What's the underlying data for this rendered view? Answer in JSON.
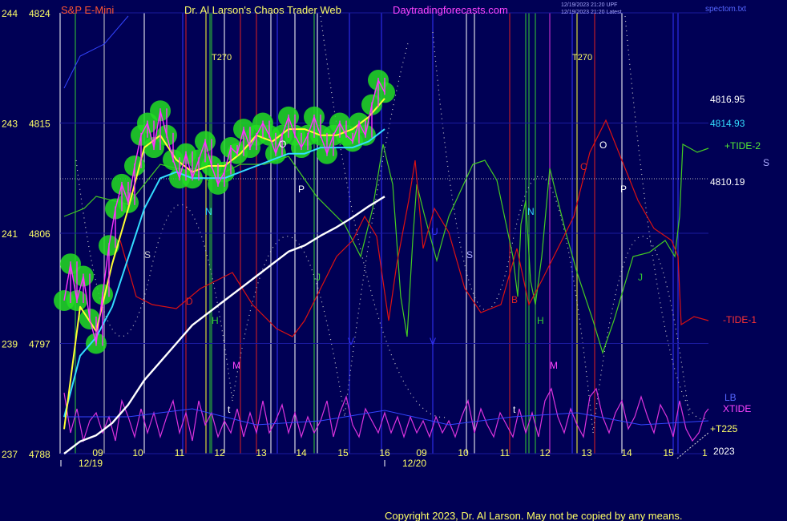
{
  "header": {
    "left_title": "S&P E-Mini",
    "center_title": "Dr. Al Larson's Chaos Trader Web",
    "site": "Daytradingforecasts.com",
    "stamp_line1": "12/19/2023 21:20 UPF",
    "stamp_line2": "12/19/2023 21:20 Latest",
    "file": "spectom.txt"
  },
  "footer": {
    "copyright": "Copyright 2023, Dr. Al Larson. May not be copied by any means."
  },
  "colors": {
    "background": "#000055",
    "price_bars": "#ff33ff",
    "glow": "#22dd22",
    "ma_fast": "#ffff33",
    "ma_mid": "#33ddff",
    "ma_slow": "#ffffff",
    "tide1": "#dd1111",
    "tide2": "#44cc22",
    "xtide": "#dd33dd"
  },
  "chart_data": {
    "type": "line",
    "title": "S&P E-Mini",
    "y_axis_left": [
      {
        "tide": "244",
        "price": "4824"
      },
      {
        "tide": "243",
        "price": "4815"
      },
      {
        "tide": "241",
        "price": "4806"
      },
      {
        "tide": "239",
        "price": "4797"
      },
      {
        "tide": "237",
        "price": "4788"
      }
    ],
    "y_range": [
      4788,
      4824
    ],
    "x_hour_labels": [
      "09",
      "10",
      "11",
      "12",
      "13",
      "14",
      "15",
      "16",
      "09",
      "10",
      "11",
      "12",
      "13",
      "14",
      "15",
      "16"
    ],
    "x_date_labels": [
      "12/19",
      "12/20"
    ],
    "right_labels": {
      "level_high": "4816.95",
      "level_last": "4814.93",
      "level_mid": "4810.19",
      "tide_plus": "+TIDE-2",
      "tide_minus": "-TIDE-1",
      "s_mark": "S",
      "lb": "LB",
      "xtide": "XTIDE",
      "t225": "+T225",
      "year": "2023",
      "partial_hour": "1"
    },
    "time_markers": [
      "T270",
      "T270"
    ],
    "planet_labels": [
      "S",
      "N",
      "O",
      "P",
      "J",
      "H",
      "M",
      "V",
      "t",
      "D",
      "U",
      "S",
      "N",
      "C",
      "O",
      "P",
      "B",
      "H",
      "M",
      "J",
      "V",
      "t"
    ],
    "series": [
      {
        "name": "price",
        "x": [
          0,
          2,
          4,
          6,
          8,
          10,
          12,
          14,
          16,
          18,
          20,
          22,
          24,
          26,
          28,
          30,
          32,
          34,
          36,
          38,
          40,
          42,
          44,
          46,
          48,
          50,
          52,
          54,
          56,
          58,
          60,
          62,
          64,
          66,
          68,
          70,
          72,
          74,
          76,
          78,
          80,
          82,
          84,
          86,
          88,
          90,
          92,
          94,
          96,
          98,
          100
        ],
        "values": [
          4800.5,
          4803.5,
          4800.5,
          4802.5,
          4799,
          4797,
          4801,
          4805,
          4808,
          4810,
          4808.5,
          4811.5,
          4814,
          4815,
          4813,
          4816,
          4814,
          4812,
          4810.5,
          4812.5,
          4810.5,
          4812,
          4813.5,
          4811.5,
          4810,
          4811,
          4813,
          4812.5,
          4814.5,
          4813,
          4814,
          4815,
          4814,
          4812.5,
          4814,
          4815.5,
          4814,
          4813,
          4814,
          4815.5,
          4814,
          4812.5,
          4814,
          4815,
          4814,
          4813.5,
          4815,
          4814,
          4816.5,
          4818.5,
          4817.5
        ]
      },
      {
        "name": "ma_fast",
        "x": [
          0,
          5,
          10,
          15,
          20,
          25,
          30,
          35,
          40,
          45,
          50,
          55,
          60,
          65,
          70,
          75,
          80,
          85,
          90,
          95,
          100
        ],
        "values": [
          4790,
          4800,
          4798,
          4803.5,
          4808,
          4813,
          4814,
          4812,
          4811,
          4811.5,
          4811.5,
          4812.5,
          4814,
          4813.5,
          4814.5,
          4814.5,
          4814,
          4814,
          4814.5,
          4815.5,
          4817
        ]
      },
      {
        "name": "ma_mid",
        "x": [
          0,
          5,
          10,
          15,
          20,
          25,
          30,
          35,
          40,
          45,
          50,
          55,
          60,
          65,
          70,
          75,
          80,
          85,
          90,
          95,
          100
        ],
        "values": [
          4791,
          4796,
          4797.5,
          4800,
          4804,
          4808,
          4810.5,
          4811,
          4810.5,
          4810.5,
          4810.5,
          4811,
          4811.5,
          4812,
          4812.5,
          4812.5,
          4813,
          4813,
          4813,
          4813.5,
          4814.5
        ]
      },
      {
        "name": "ma_slow",
        "x": [
          0,
          5,
          10,
          15,
          20,
          25,
          30,
          35,
          40,
          45,
          50,
          55,
          60,
          65,
          70,
          75,
          80,
          85,
          90,
          95,
          100
        ],
        "values": [
          4788,
          4789,
          4789.5,
          4790.5,
          4792,
          4794,
          4795.5,
          4797,
          4798.5,
          4799.5,
          4800.5,
          4801.5,
          4802.5,
          4803.5,
          4804.5,
          4805,
          4805.8,
          4806.5,
          4807.3,
          4808.2,
          4809
        ]
      }
    ]
  }
}
